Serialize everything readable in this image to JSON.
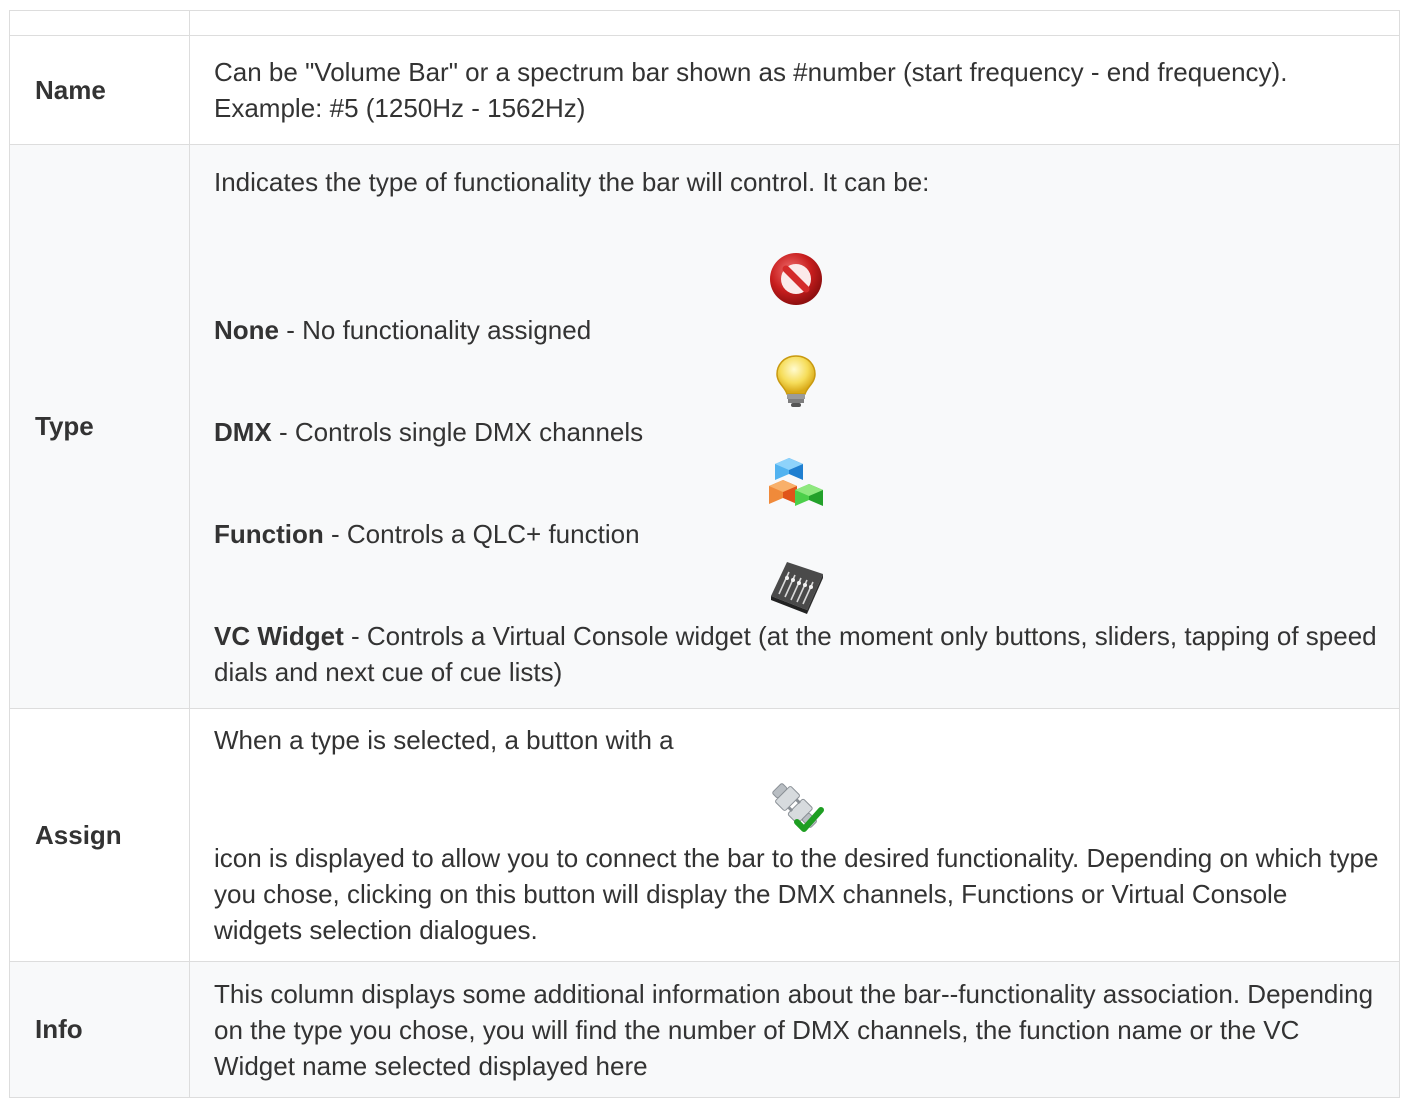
{
  "rows": [
    {
      "label": "Name",
      "text": "Can be \"Volume Bar\" or a spectrum bar shown as #number (start frequency - end frequency). Example: #5 (1250Hz - 1562Hz)"
    },
    {
      "label": "Type",
      "intro": "Indicates the type of functionality the bar will control. It can be:",
      "options": [
        {
          "name": "None",
          "desc": " - No functionality assigned",
          "icon": "no-entry-icon"
        },
        {
          "name": "DMX",
          "desc": " - Controls single DMX channels",
          "icon": "lightbulb-icon"
        },
        {
          "name": "Function",
          "desc": " - Controls a QLC+ function",
          "icon": "cubes-icon"
        },
        {
          "name": "VC Widget",
          "desc": " - Controls a Virtual Console widget (at the moment only buttons, sliders, tapping of speed dials and next cue of cue lists)",
          "icon": "mixer-console-icon"
        }
      ]
    },
    {
      "label": "Assign",
      "text_before": "When a type is selected, a button with a",
      "icon": "plug-check-icon",
      "text_after": "icon is displayed to allow you to connect the bar to the desired functionality. Depending on which type you chose, clicking on this button will display the DMX channels, Functions or Virtual Console widgets selection dialogues."
    },
    {
      "label": "Info",
      "text": "This column displays some additional information about the bar--functionality association. Depending on the type you chose, you will find the number of DMX channels, the function name or the VC Widget name selected displayed here"
    }
  ]
}
